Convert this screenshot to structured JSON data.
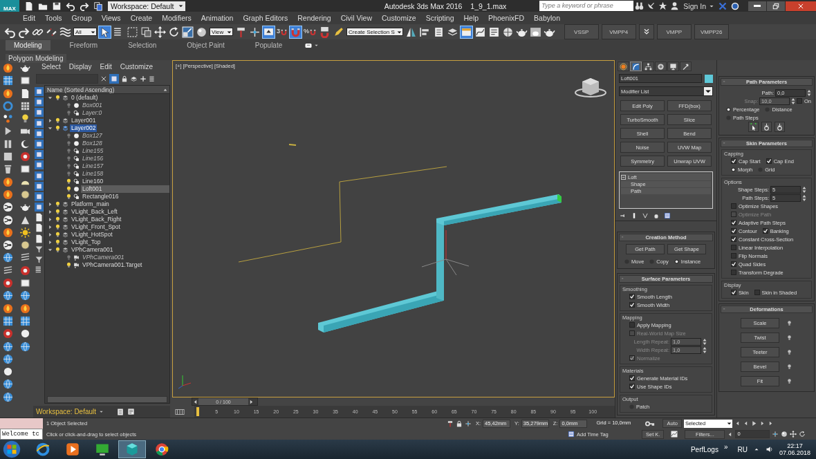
{
  "title_bar": {
    "app_label": "MAX",
    "workspace": "Workspace: Default",
    "title": "Autodesk 3ds Max 2016",
    "file": "1_9_1.max",
    "search": {
      "placeholder": "Type a keyword or phrase"
    },
    "sign_in": "Sign In"
  },
  "menu": [
    "Edit",
    "Tools",
    "Group",
    "Views",
    "Create",
    "Modifiers",
    "Animation",
    "Graph Editors",
    "Rendering",
    "Civil View",
    "Customize",
    "Scripting",
    "Help",
    "PhoenixFD",
    "Babylon"
  ],
  "main_toolbar": {
    "items": [
      {
        "kind": "undo",
        "on": false
      },
      {
        "kind": "redo",
        "on": false
      },
      {
        "kind": "link",
        "on": false
      },
      {
        "kind": "unlink",
        "on": false
      },
      {
        "kind": "bind",
        "on": false
      },
      {
        "kind": "dropdown",
        "value": "All"
      },
      {
        "kind": "select",
        "on": true
      },
      {
        "kind": "select_by_name",
        "on": false
      },
      {
        "kind": "region",
        "on": false
      },
      {
        "kind": "window",
        "on": false
      },
      {
        "kind": "move",
        "on": false
      },
      {
        "kind": "rotate",
        "on": false
      },
      {
        "kind": "scale",
        "on": false
      },
      {
        "kind": "place",
        "on": false
      },
      {
        "kind": "dropdown",
        "value": "View"
      },
      {
        "kind": "pivot",
        "on": false
      },
      {
        "kind": "manipulate",
        "on": false
      },
      {
        "kind": "keyboard",
        "on": true
      },
      {
        "kind": "snap",
        "label": "3",
        "on": false
      },
      {
        "kind": "angle_snap",
        "on": true
      },
      {
        "kind": "snap",
        "label": "%",
        "on": false
      },
      {
        "kind": "spinner_snap",
        "on": false
      },
      {
        "kind": "edit_named",
        "on": false
      },
      {
        "kind": "dropdown",
        "value": "Create Selection S"
      },
      {
        "kind": "mirror",
        "on": false
      },
      {
        "kind": "align",
        "on": false
      },
      {
        "kind": "layers",
        "on": false
      },
      {
        "kind": "explorer",
        "on": false
      },
      {
        "kind": "ribbon",
        "on": true
      },
      {
        "kind": "curve",
        "on": false
      },
      {
        "kind": "schematic",
        "on": false
      },
      {
        "kind": "material",
        "on": false
      },
      {
        "kind": "render_setup",
        "on": false
      },
      {
        "kind": "frame",
        "on": false
      },
      {
        "kind": "render",
        "on": false
      }
    ],
    "buttons": [
      "VSSP",
      "VMPP4",
      "VMPP",
      "VMPP26"
    ]
  },
  "ribbon": {
    "tabs": [
      {
        "label": "Modeling",
        "selected": true
      },
      {
        "label": "Freeform",
        "selected": false
      },
      {
        "label": "Selection",
        "selected": false
      },
      {
        "label": "Object Paint",
        "selected": false
      },
      {
        "label": "Populate",
        "selected": false
      }
    ],
    "panel": "Polygon Modeling"
  },
  "scene_explorer": {
    "menu": [
      "Select",
      "Display",
      "Edit",
      "Customize"
    ],
    "column": "Name (Sorted Ascending)",
    "items": [
      {
        "name": "0 (default)",
        "kind": "layer",
        "hidden": false,
        "selected": false,
        "expanded": true,
        "children": [
          {
            "name": "Box001",
            "kind": "geometry",
            "hidden": true,
            "selected": false
          },
          {
            "name": "Layer:0",
            "kind": "shape",
            "hidden": true,
            "selected": false
          }
        ]
      },
      {
        "name": "Layer001",
        "kind": "layer",
        "hidden": false,
        "selected": false,
        "expanded": false
      },
      {
        "name": "Layer002",
        "kind": "layer",
        "hidden": false,
        "selected": true,
        "expanded": true,
        "children": [
          {
            "name": "Box127",
            "kind": "geometry",
            "hidden": true,
            "selected": false
          },
          {
            "name": "Box128",
            "kind": "geometry",
            "hidden": true,
            "selected": false
          },
          {
            "name": "Line155",
            "kind": "shape",
            "hidden": true,
            "selected": false
          },
          {
            "name": "Line156",
            "kind": "shape",
            "hidden": true,
            "selected": false
          },
          {
            "name": "Line157",
            "kind": "shape",
            "hidden": true,
            "selected": false
          },
          {
            "name": "Line158",
            "kind": "shape",
            "hidden": true,
            "selected": false
          },
          {
            "name": "Line160",
            "kind": "shape",
            "hidden": false,
            "selected": false
          },
          {
            "name": "Loft001",
            "kind": "geometry",
            "hidden": false,
            "selected": true
          },
          {
            "name": "Rectangle016",
            "kind": "shape",
            "hidden": false,
            "selected": false
          }
        ]
      },
      {
        "name": "Platform_main",
        "kind": "layer",
        "hidden": false,
        "selected": false,
        "expanded": false
      },
      {
        "name": "VLight_Back_Left",
        "kind": "layer",
        "hidden": false,
        "selected": false,
        "expanded": false
      },
      {
        "name": "VLight_Back_Right",
        "kind": "layer",
        "hidden": false,
        "selected": false,
        "expanded": false
      },
      {
        "name": "VLight_Front_Spot",
        "kind": "layer",
        "hidden": false,
        "selected": false,
        "expanded": false
      },
      {
        "name": "VLight_HotSpot",
        "kind": "layer",
        "hidden": false,
        "selected": false,
        "expanded": false
      },
      {
        "name": "VLight_Top",
        "kind": "layer",
        "hidden": false,
        "selected": false,
        "expanded": false
      },
      {
        "name": "VPhCamera001",
        "kind": "layer",
        "hidden": false,
        "selected": false,
        "expanded": true,
        "children": [
          {
            "name": "VPhCamera001",
            "kind": "camera",
            "hidden": true,
            "selected": false
          },
          {
            "name": "VPhCamera001.Target",
            "kind": "camera",
            "hidden": false,
            "selected": false
          }
        ]
      }
    ],
    "workspace": "Workspace: Default"
  },
  "viewport": {
    "labels": [
      "[+]",
      "[Perspective]",
      "[Shaded]"
    ]
  },
  "time_slider": {
    "frame": "0 / 100",
    "ticks": [
      "5",
      "10",
      "15",
      "20",
      "25",
      "30",
      "35",
      "40",
      "45",
      "50",
      "55",
      "60",
      "65",
      "70",
      "75",
      "80",
      "85",
      "90",
      "95",
      "100"
    ]
  },
  "command_panel": {
    "tabs": [
      {
        "kind": "create",
        "selected": false
      },
      {
        "kind": "modify",
        "selected": true
      },
      {
        "kind": "hierarchy",
        "selected": false
      },
      {
        "kind": "motion",
        "selected": false
      },
      {
        "kind": "display",
        "selected": false
      },
      {
        "kind": "utilities",
        "selected": false
      }
    ],
    "object_name": "Loft001",
    "modifier_list": "Modifier List",
    "modifier_buttons": [
      "Edit Poly",
      "FFD(box)",
      "TurboSmooth",
      "Slice",
      "Shell",
      "Bend",
      "Noise",
      "UVW Map",
      "Symmetry",
      "Unwrap UVW"
    ],
    "stack": [
      {
        "label": "Loft",
        "expanded": true,
        "children": [
          {
            "label": "Shape"
          },
          {
            "label": "Path"
          }
        ]
      }
    ],
    "rollouts": [
      {
        "title": "Creation Method",
        "groups": [
          {
            "rows": [
              [
                {
                  "kind": "button",
                  "label": "Get Path"
                },
                {
                  "kind": "button",
                  "label": "Get Shape"
                }
              ]
            ]
          },
          {
            "rows": [
              [
                {
                  "kind": "radio",
                  "label": "Move",
                  "selected": false
                },
                {
                  "kind": "radio",
                  "label": "Copy",
                  "selected": false
                },
                {
                  "kind": "radio",
                  "label": "Instance",
                  "selected": true
                }
              ]
            ]
          }
        ]
      },
      {
        "title": "Surface Parameters",
        "groups": [
          {
            "title": "Smoothing",
            "rows": [
              [
                {
                  "kind": "checkbox",
                  "label": "Smooth Length",
                  "checked": true,
                  "disabled": false
                }
              ],
              [
                {
                  "kind": "checkbox",
                  "label": "Smooth Width",
                  "checked": true,
                  "disabled": false
                }
              ]
            ]
          },
          {
            "title": "Mapping",
            "rows": [
              [
                {
                  "kind": "checkbox",
                  "label": "Apply Mapping",
                  "checked": false,
                  "disabled": false
                }
              ],
              [
                {
                  "kind": "checkbox",
                  "label": "Real-World Map Size",
                  "checked": false,
                  "disabled": true
                }
              ],
              [
                {
                  "kind": "spinner",
                  "label": "Length Repeat:",
                  "value": "1,0",
                  "disabled": true
                }
              ],
              [
                {
                  "kind": "spinner",
                  "label": "Width Repeat:",
                  "value": "1,0",
                  "disabled": true
                }
              ],
              [
                {
                  "kind": "checkbox",
                  "label": "Normalize",
                  "checked": true,
                  "disabled": true
                }
              ]
            ]
          },
          {
            "title": "Materials",
            "rows": [
              [
                {
                  "kind": "checkbox",
                  "label": "Generate Material IDs",
                  "checked": true,
                  "disabled": false
                }
              ],
              [
                {
                  "kind": "checkbox",
                  "label": "Use Shape IDs",
                  "checked": true,
                  "disabled": false
                }
              ]
            ]
          },
          {
            "title": "Output",
            "rows": [
              [
                {
                  "kind": "radio",
                  "label": "Patch",
                  "selected": false
                }
              ]
            ]
          }
        ]
      }
    ]
  },
  "rollouts": [
    {
      "title": "Path Parameters",
      "groups": [
        {
          "rows": [
            [
              {
                "kind": "spinner",
                "label": "Path:",
                "value": "0,0",
                "disabled": false
              }
            ],
            [
              {
                "kind": "spinner",
                "label": "Snap:",
                "value": "10,0",
                "disabled": true
              },
              {
                "kind": "checkbox",
                "label": "On",
                "checked": false,
                "disabled": false
              }
            ],
            [
              {
                "kind": "radio",
                "label": "Percentage",
                "selected": true
              },
              {
                "kind": "radio",
                "label": "Distance",
                "selected": false
              }
            ],
            [
              {
                "kind": "radio",
                "label": "Path Steps",
                "selected": false
              }
            ],
            [
              {
                "kind": "pick_tool"
              },
              {
                "kind": "shape_tool"
              },
              {
                "kind": "shape_tool"
              }
            ]
          ]
        }
      ]
    },
    {
      "title": "Skin Parameters",
      "groups": [
        {
          "title": "Capping",
          "rows": [
            [
              {
                "kind": "checkbox",
                "label": "Cap Start",
                "checked": true,
                "disabled": false
              },
              {
                "kind": "checkbox",
                "label": "Cap End",
                "checked": true,
                "disabled": false
              }
            ],
            [
              {
                "kind": "radio",
                "label": "Morph",
                "selected": true
              },
              {
                "kind": "radio",
                "label": "Grid",
                "selected": false
              }
            ]
          ]
        },
        {
          "title": "Options",
          "rows": [
            [
              {
                "kind": "spinner",
                "label": "Shape Steps:",
                "value": "5",
                "disabled": false
              }
            ],
            [
              {
                "kind": "spinner",
                "label": "Path Steps:",
                "value": "5",
                "disabled": false
              }
            ],
            [
              {
                "kind": "checkbox",
                "label": "Optimize Shapes",
                "checked": false,
                "disabled": false
              }
            ],
            [
              {
                "kind": "checkbox",
                "label": "Optimize Path",
                "checked": false,
                "disabled": true
              }
            ],
            [
              {
                "kind": "checkbox",
                "label": "Adaptive Path Steps",
                "checked": true,
                "disabled": false
              }
            ],
            [
              {
                "kind": "checkbox",
                "label": "Contour",
                "checked": true,
                "disabled": false
              },
              {
                "kind": "checkbox",
                "label": "Banking",
                "checked": true,
                "disabled": false
              }
            ],
            [
              {
                "kind": "checkbox",
                "label": "Constant Cross-Section",
                "checked": true,
                "disabled": false
              }
            ],
            [
              {
                "kind": "checkbox",
                "label": "Linear Interpolation",
                "checked": false,
                "disabled": false
              }
            ],
            [
              {
                "kind": "checkbox",
                "label": "Flip Normals",
                "checked": false,
                "disabled": false
              }
            ],
            [
              {
                "kind": "checkbox",
                "label": "Quad Sides",
                "checked": true,
                "disabled": false
              }
            ],
            [
              {
                "kind": "checkbox",
                "label": "Transform Degrade",
                "checked": false,
                "disabled": false
              }
            ]
          ]
        },
        {
          "title": "Display",
          "rows": [
            [
              {
                "kind": "checkbox",
                "label": "Skin",
                "checked": true,
                "disabled": false
              },
              {
                "kind": "checkbox",
                "label": "Skin in Shaded",
                "checked": false,
                "disabled": false
              }
            ]
          ]
        }
      ]
    },
    {
      "title": "Deformations",
      "groups": [
        {
          "rows": [
            [
              {
                "kind": "deform",
                "label": "Scale"
              }
            ],
            [
              {
                "kind": "deform",
                "label": "Twist"
              }
            ],
            [
              {
                "kind": "deform",
                "label": "Teeter"
              }
            ],
            [
              {
                "kind": "deform",
                "label": "Bevel"
              }
            ],
            [
              {
                "kind": "deform",
                "label": "Fit"
              }
            ]
          ]
        }
      ]
    }
  ],
  "status_bar": {
    "listener": "Welcome tc",
    "selection": "1 Object Selected",
    "prompt": "Click or click-and-drag to select objects",
    "coords": [
      {
        "label": "X:",
        "value": "45,42mm"
      },
      {
        "label": "Y:",
        "value": "35,279mm"
      },
      {
        "label": "Z:",
        "value": "0,0mm"
      }
    ],
    "grid": "Grid = 10,0mm",
    "add_time_tag": "Add Time Tag",
    "auto_key": "Auto",
    "key_filter": "Selected",
    "set_key": "Set K.",
    "filters": "Filters...",
    "frame": "0"
  },
  "taskbar": {
    "apps": [
      {
        "kind": "browser",
        "selected": false
      },
      {
        "kind": "media",
        "selected": false
      },
      {
        "kind": "computer",
        "selected": false
      },
      {
        "kind": "max",
        "selected": true
      },
      {
        "kind": "chrome",
        "selected": false
      }
    ],
    "folder": "PerfLogs",
    "chevron": "»",
    "language": "RU",
    "time": "22:17",
    "date": "07.06.2018"
  }
}
